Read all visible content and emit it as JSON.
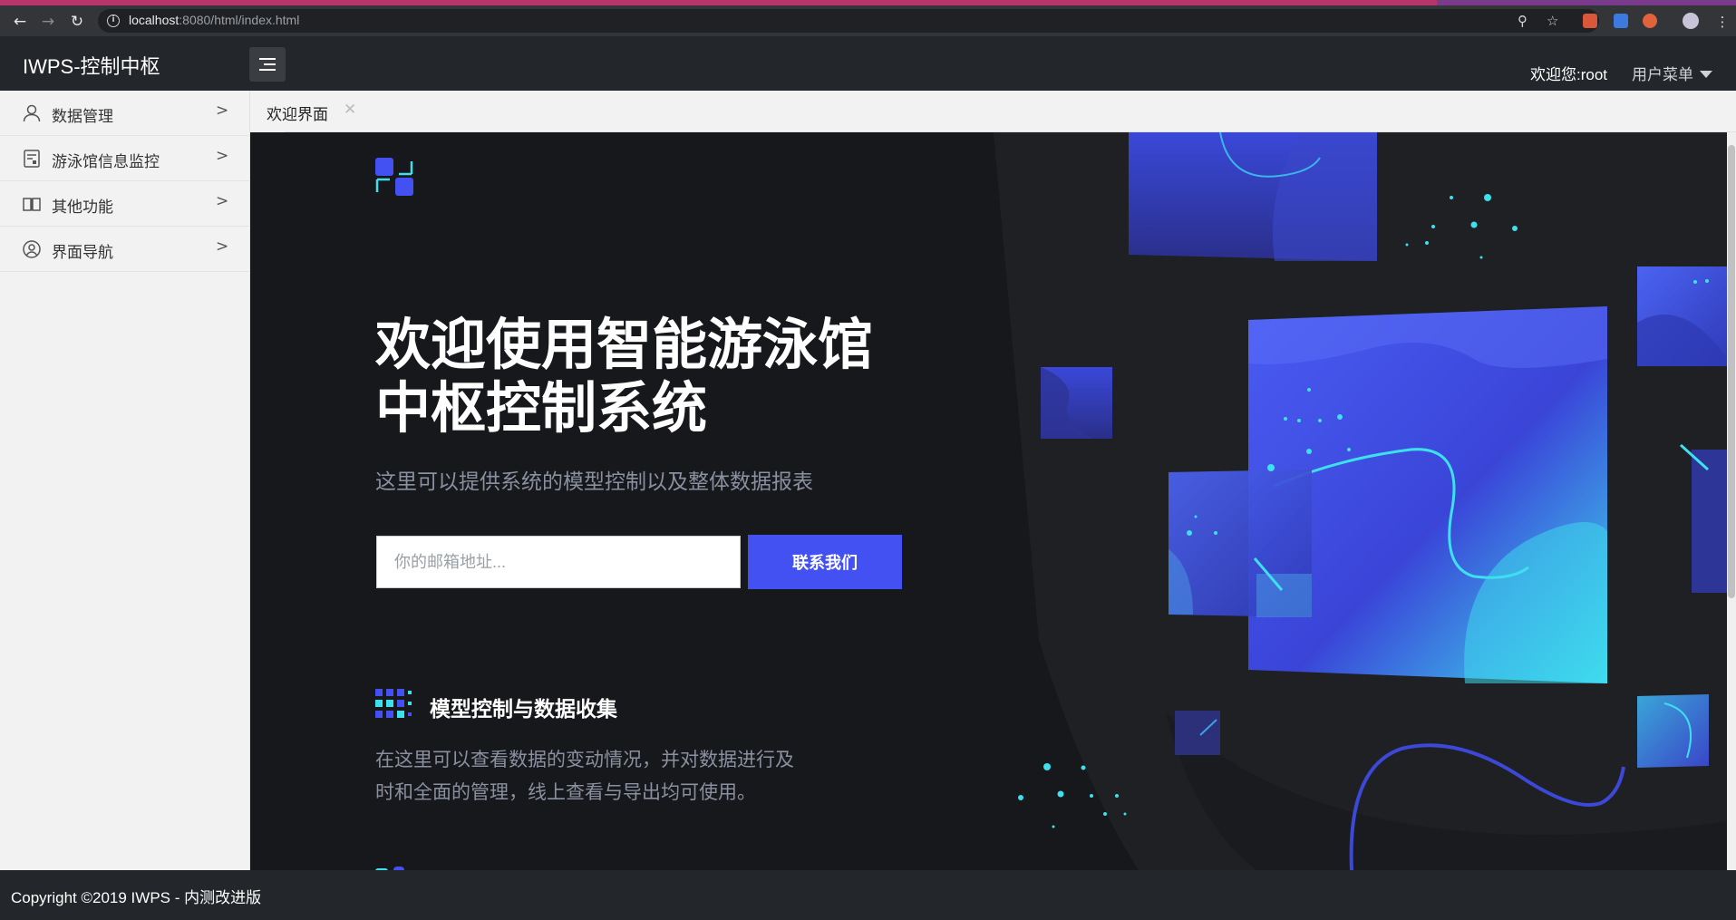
{
  "browser": {
    "url_host": "localhost",
    "url_path": ":8080/html/index.html"
  },
  "header": {
    "brand": "IWPS-控制中枢",
    "welcome": "欢迎您:root",
    "user_menu": "用户菜单"
  },
  "sidebar": {
    "items": [
      {
        "label": "数据管理",
        "icon": "user-icon"
      },
      {
        "label": "游泳馆信息监控",
        "icon": "monitor-icon"
      },
      {
        "label": "其他功能",
        "icon": "book-icon"
      },
      {
        "label": "界面导航",
        "icon": "user-circle-icon"
      }
    ]
  },
  "tabs": [
    {
      "label": "欢迎界面",
      "active": true
    }
  ],
  "hero": {
    "title_line1": "欢迎使用智能游泳馆",
    "title_line2": "中枢控制系统",
    "subtitle": "这里可以提供系统的模型控制以及整体数据报表",
    "email_placeholder": "你的邮箱地址...",
    "contact_button": "联系我们"
  },
  "feature": {
    "title": "模型控制与数据收集",
    "description_line1": "在这里可以查看数据的变动情况，并对数据进行及",
    "description_line2": "时和全面的管理，线上查看与导出均可使用。"
  },
  "footer": {
    "copyright": "Copyright ©2019 IWPS - 内测改进版"
  },
  "colors": {
    "accent": "#4451f2",
    "header_bg": "#23262b",
    "content_bg": "#17181b",
    "cyan": "#3ee0ee"
  }
}
